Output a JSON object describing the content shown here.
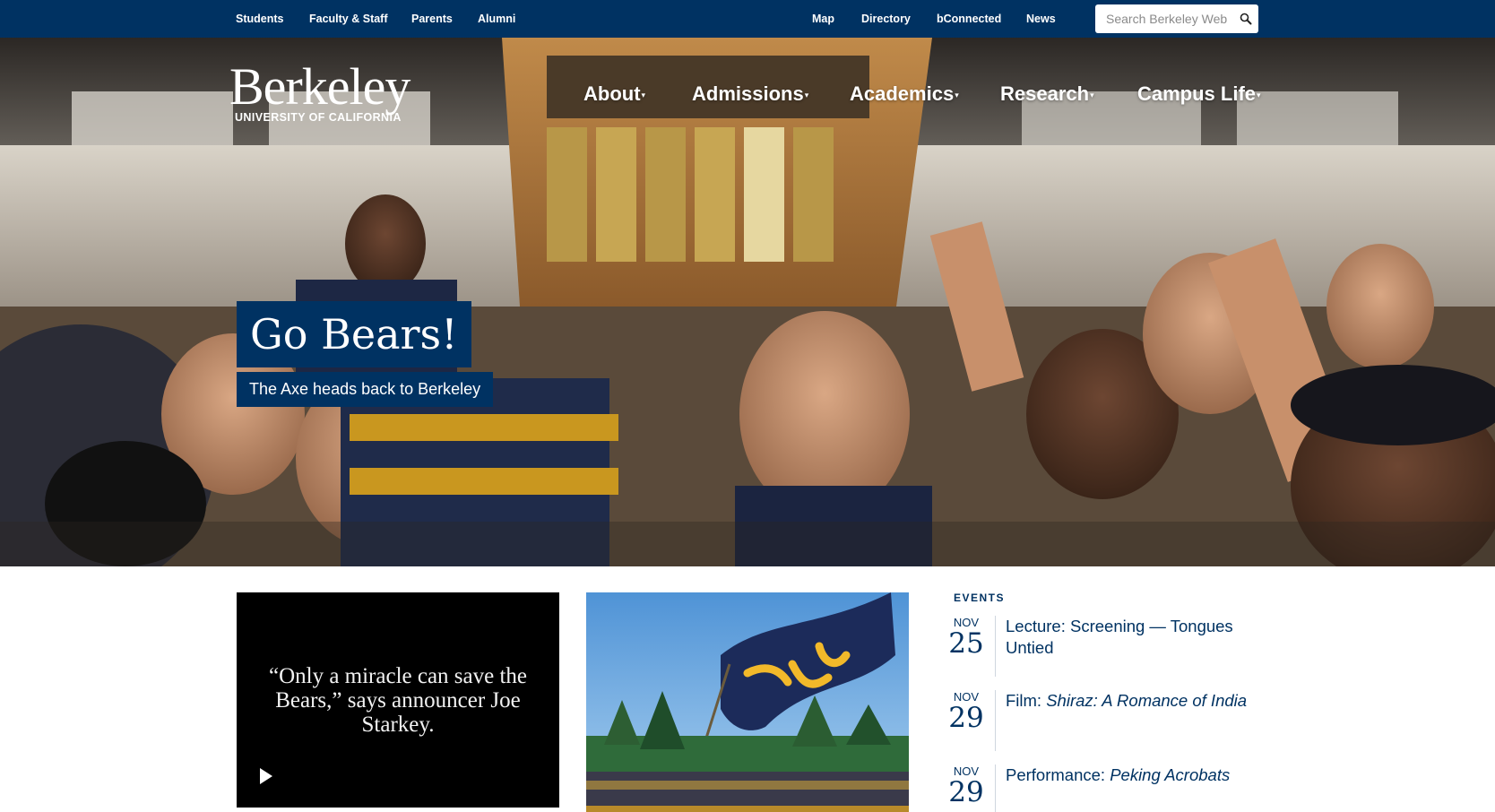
{
  "utility_nav": {
    "left_links": [
      "Students",
      "Faculty & Staff",
      "Parents",
      "Alumni"
    ],
    "right_links": [
      "Map",
      "Directory",
      "bConnected",
      "News"
    ],
    "search": {
      "placeholder": "Search Berkeley Web",
      "icon": "search-icon"
    }
  },
  "logo": {
    "wordmark": "Berkeley",
    "subtitle": "UNIVERSITY OF CALIFORNIA"
  },
  "main_nav": {
    "items": [
      {
        "label": "About",
        "icon": "caret-down-icon"
      },
      {
        "label": "Admissions",
        "icon": "caret-down-icon"
      },
      {
        "label": "Academics",
        "icon": "caret-down-icon"
      },
      {
        "label": "Research",
        "icon": "caret-down-icon"
      },
      {
        "label": "Campus Life",
        "icon": "caret-down-icon"
      }
    ],
    "caret": "▾"
  },
  "hero": {
    "title": "Go Bears!",
    "subtitle": "The Axe heads back to Berkeley"
  },
  "cards": {
    "video": {
      "quote": "“Only a miracle can save the Bears,” says announcer Joe Starkey.",
      "icon": "play-icon"
    },
    "photo": {
      "image": "cal-flag-photo"
    }
  },
  "events": {
    "heading": "EVENTS",
    "items": [
      {
        "month": "NOV",
        "day": "25",
        "title": "Lecture: Screening — Tongues Untied",
        "title_prefix": "Lecture: Screening — Tongues Untied",
        "title_italic": ""
      },
      {
        "month": "NOV",
        "day": "29",
        "title": "Film: Shiraz: A Romance of India",
        "title_prefix": "Film: ",
        "title_italic": "Shiraz: A Romance of India"
      },
      {
        "month": "NOV",
        "day": "29",
        "title": "Performance: Peking Acrobats",
        "title_prefix": "Performance: ",
        "title_italic": "Peking Acrobats"
      }
    ]
  },
  "colors": {
    "berkeley_blue": "#003262",
    "california_gold": "#FDB515",
    "white": "#FFFFFF"
  }
}
